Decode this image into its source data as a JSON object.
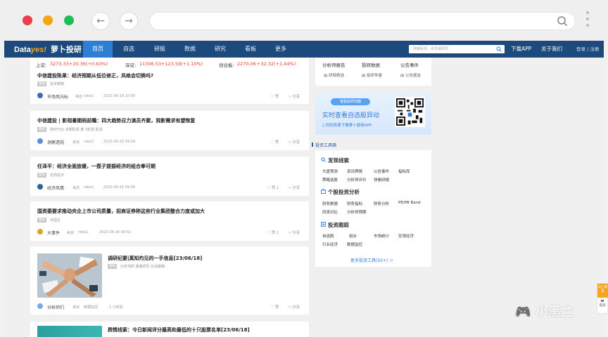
{
  "browser": {
    "back_label": "←",
    "forward_label": "→"
  },
  "header": {
    "logo_prefix": "Data",
    "logo_yes": "yes!",
    "logo_cn": "萝卜投研",
    "nav": [
      "首页",
      "自选",
      "研报",
      "数据",
      "研究",
      "看板",
      "更多"
    ],
    "active_nav": "首页",
    "search_placeholder": "搜索股票、资讯或研究",
    "download_app": "下载APP",
    "about_us": "关于我们",
    "login": "登录 | 注册"
  },
  "ticker": {
    "sh_label": "上证:",
    "sh_value": "3273.33",
    "sh_change": "+20.36",
    "sh_pct": "(+0.63%)",
    "sz_label": "深证:",
    "sz_value": "11306.53",
    "sz_change": "+123.59",
    "sz_pct": "(+1.10%)",
    "cy_label": "创业板:",
    "cy_value": "2270.06",
    "cy_change": "+32.32",
    "cy_pct": "(+1.44%)"
  },
  "feed": [
    {
      "title": "中信建投陈果：经济预期从低位修正，风格会切换吗?",
      "tag": "相关",
      "tag_text": "投资策略",
      "source": "市场风向标",
      "from": "来自",
      "author": "robo1",
      "time": "2023-06-18 10:00",
      "likes": "赞",
      "share": "分享"
    },
    {
      "title": "中信建投 | 影视暑期档前瞻：四大趋势召力演员齐聚，观影需求有望恢复",
      "tag": "相关",
      "tag_text": "院线于此   本期影视   暑飞影视   影视",
      "source": "洞察透视",
      "from": "来自",
      "author": "robo1",
      "time": "2023-06-16 09:59",
      "likes": "赞",
      "share": "分享"
    },
    {
      "title": "任泽平：经济全面放缓，一揽子提振经济的组合拳可期",
      "tag": "相关",
      "tag_text": "宏观经济",
      "source": "经济风情",
      "from": "来自",
      "author": "robo1",
      "time": "2023-06-16 09:56",
      "likes": "赞 1",
      "share": "分享"
    },
    {
      "title": "国资委要求推动央企上市公司质量，招商证券称这些行业集团整合力度或加大",
      "tag": "相关",
      "tag_text": "央国企",
      "source": "大事件",
      "from": "来自",
      "author": "robo1",
      "time": "2023-06-16 08:52",
      "likes": "赞 1",
      "share": "分享"
    },
    {
      "title": "调研纪要|真知灼见的一手信息[23/06/18]",
      "tag": "相关",
      "tag_text": "分析师研   路路研究   长线策略",
      "source": "分析师们",
      "from": "来自",
      "author": "数据监控",
      "time": "1 小时前",
      "likes": "赞",
      "share": "分享"
    },
    {
      "title": "舆情线索：今日新闻评分最高和最低的十只股票名单[23/06/18]",
      "tag": "相关",
      "tag_text": "",
      "source": "",
      "from": "",
      "author": "",
      "time": "",
      "likes": "",
      "share": ""
    }
  ],
  "quick_links": {
    "row1": [
      "分析师报告",
      "投研数据",
      "公告事件"
    ],
    "row2": [
      "研报精选",
      "投研导鉴",
      "公告掘金"
    ]
  },
  "banner": {
    "pill": "智能投研利器",
    "headline": "实时查看自选股异动",
    "sub": "扫码免费下载萝卜投研APP"
  },
  "tools_section_label": "投资工具箱",
  "tools": [
    {
      "heading": "发现线索",
      "items": [
        "大盘预测",
        "资讯舆情",
        "公告事件",
        "指标库",
        "策略选股",
        "分析师评价",
        "快看研报"
      ]
    },
    {
      "heading": "个股投资分析",
      "items": [
        "财务数据",
        "财务指标",
        "财务分析",
        "PE/PB Band",
        "同类对比",
        "分析师预期"
      ]
    },
    {
      "heading": "投资跟踪",
      "items": [
        "自选股",
        "组合",
        "市场统计",
        "宏观经济",
        "行业经济",
        "数据监控"
      ]
    }
  ],
  "tools_more": "更多投资工具(50+) ＞",
  "side_float": {
    "top": "马上联系",
    "bottom": "电话"
  },
  "watermark": "小黑盒",
  "colors": {
    "header_bg": "#1c4a7c",
    "nav_active": "#2d7fd3",
    "up": "#e03c31",
    "accent": "#2f7ce0"
  }
}
